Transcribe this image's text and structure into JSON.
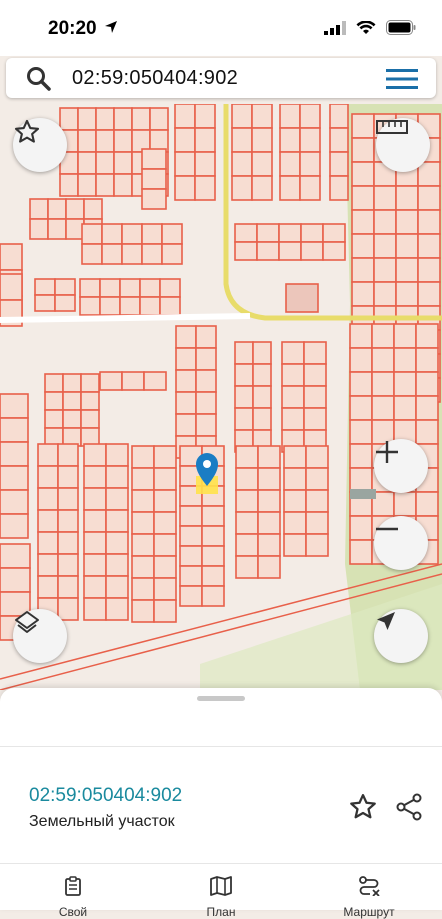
{
  "status_bar": {
    "time": "20:20"
  },
  "search": {
    "value": "02:59:050404:902"
  },
  "parcel": {
    "id": "02:59:050404:902",
    "type": "Земельный участок"
  },
  "tabs": [
    {
      "label": "Свой",
      "icon": "clipboard-icon"
    },
    {
      "label": "План",
      "icon": "map-icon"
    },
    {
      "label": "Маршрут",
      "icon": "route-icon"
    }
  ],
  "colors": {
    "parcel_outline": "#e8604a",
    "parcel_fill": "#f7ddd2",
    "road": "#e8dc6a",
    "link": "#1a8a9e",
    "green_area": "#cfe0a8"
  }
}
